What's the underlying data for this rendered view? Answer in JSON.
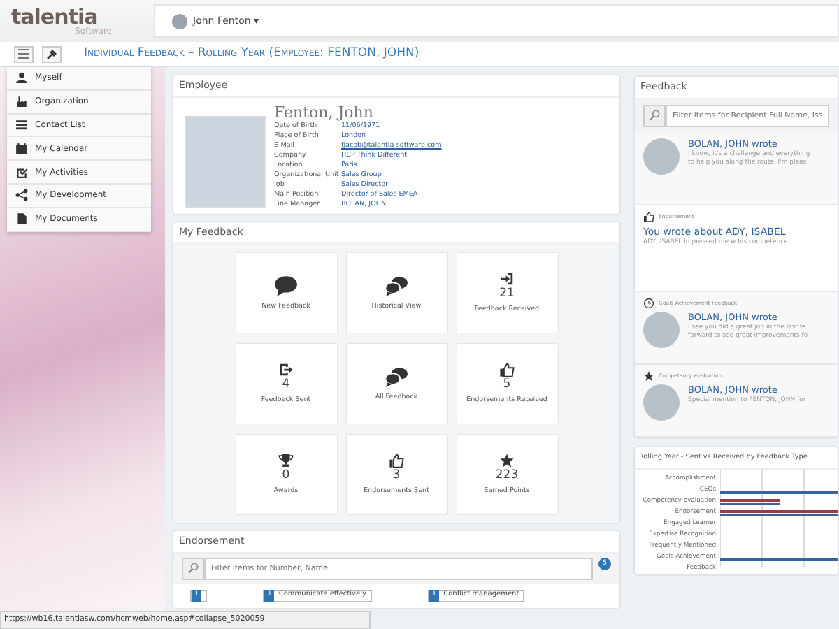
{
  "header": {
    "logo": "talentia",
    "logo_sub": "Software",
    "user": "John Fenton",
    "caret": "▾"
  },
  "title": "Individual Feedback – Rolling Year (Employee: FENTON, JOHN)",
  "menu": [
    {
      "label": "Myself"
    },
    {
      "label": "Organization"
    },
    {
      "label": "Contact List"
    },
    {
      "label": "My Calendar"
    },
    {
      "label": "My Activities"
    },
    {
      "label": "My Development"
    },
    {
      "label": "My Documents"
    }
  ],
  "employee": {
    "heading": "Employee",
    "name": "Fenton, John",
    "fields": [
      {
        "label": "Date of Birth",
        "value": "11/06/1971",
        "kind": "text"
      },
      {
        "label": "Place of Birth",
        "value": "London",
        "kind": "text"
      },
      {
        "label": "E-Mail",
        "value": "fjacob@talentia-software.com",
        "kind": "link"
      },
      {
        "label": "Company",
        "value": "HCP Think Different",
        "kind": "text"
      },
      {
        "label": "Location",
        "value": "Paris",
        "kind": "text"
      },
      {
        "label": "Organizational Unit",
        "value": "Sales Group",
        "kind": "text"
      },
      {
        "label": "Job",
        "value": "Sales Director",
        "kind": "text"
      },
      {
        "label": "Main Position",
        "value": "Director of Sales EMEA",
        "kind": "text"
      },
      {
        "label": "Line Manager",
        "value": "BOLAN, JOHN",
        "kind": "text"
      }
    ]
  },
  "my_feedback": {
    "heading": "My Feedback",
    "tiles": [
      {
        "label": "New Feedback"
      },
      {
        "label": "Historical View"
      },
      {
        "count": "21",
        "label": "Feedback Received"
      },
      {
        "count": "4",
        "label": "Feedback Sent"
      },
      {
        "label": "All Feedback"
      },
      {
        "count": "5",
        "label": "Endorsements Received"
      },
      {
        "count": "0",
        "label": "Awards"
      },
      {
        "count": "3",
        "label": "Endorsements Sent"
      },
      {
        "count": "223",
        "label": "Earned Points"
      }
    ]
  },
  "endorsement": {
    "heading": "Endorsement",
    "placeholder": "Filter items for Number, Name",
    "badge": "5",
    "chips": [
      {
        "count": "1"
      },
      {
        "count": "1",
        "label": "Communicate effectively"
      },
      {
        "count": "1",
        "label": "Conflict management"
      }
    ]
  },
  "feedback_panel": {
    "heading": "Feedback",
    "placeholder": "Filter items for Recipient Full Name, Iss",
    "items": [
      {
        "kind": "wrote",
        "author": "BOLAN, JOHN",
        "verb": "wrote",
        "lines": [
          "I know, it's a challenge and everything",
          "to help you along the route. I'm pleas"
        ]
      },
      {
        "kind": "about",
        "tag": "Endorsement",
        "headline": "You wrote about ADY, ISABEL",
        "lines": [
          "ADY, ISABEL impressed me w his competence."
        ]
      },
      {
        "kind": "wrote",
        "tag": "Goals Achievement Feedback",
        "author": "BOLAN, JOHN",
        "verb": "wrote",
        "lines": [
          "I see you did a great job in the last fe",
          "forward to see great improvements fo"
        ]
      },
      {
        "kind": "wrote",
        "tag": "Competency evaluation",
        "author": "BOLAN, JOHN",
        "verb": "wrote",
        "lines": [
          "Special mention to FENTON, JOHN for"
        ]
      }
    ]
  },
  "chart": {
    "title": "Rolling Year - Sent vs Received by Feedback Type",
    "categories": [
      "Accomplishment",
      "CEOs",
      "Competency evaluation",
      "Endorsement",
      "Engaged Learner",
      "Expertise Recognition",
      "Frequently Mentioned",
      "Goals Achievement Feedback"
    ]
  },
  "status_bar": "https://wb16.talentiasw.com/hcmweb/home.asp#collapse_5020059"
}
